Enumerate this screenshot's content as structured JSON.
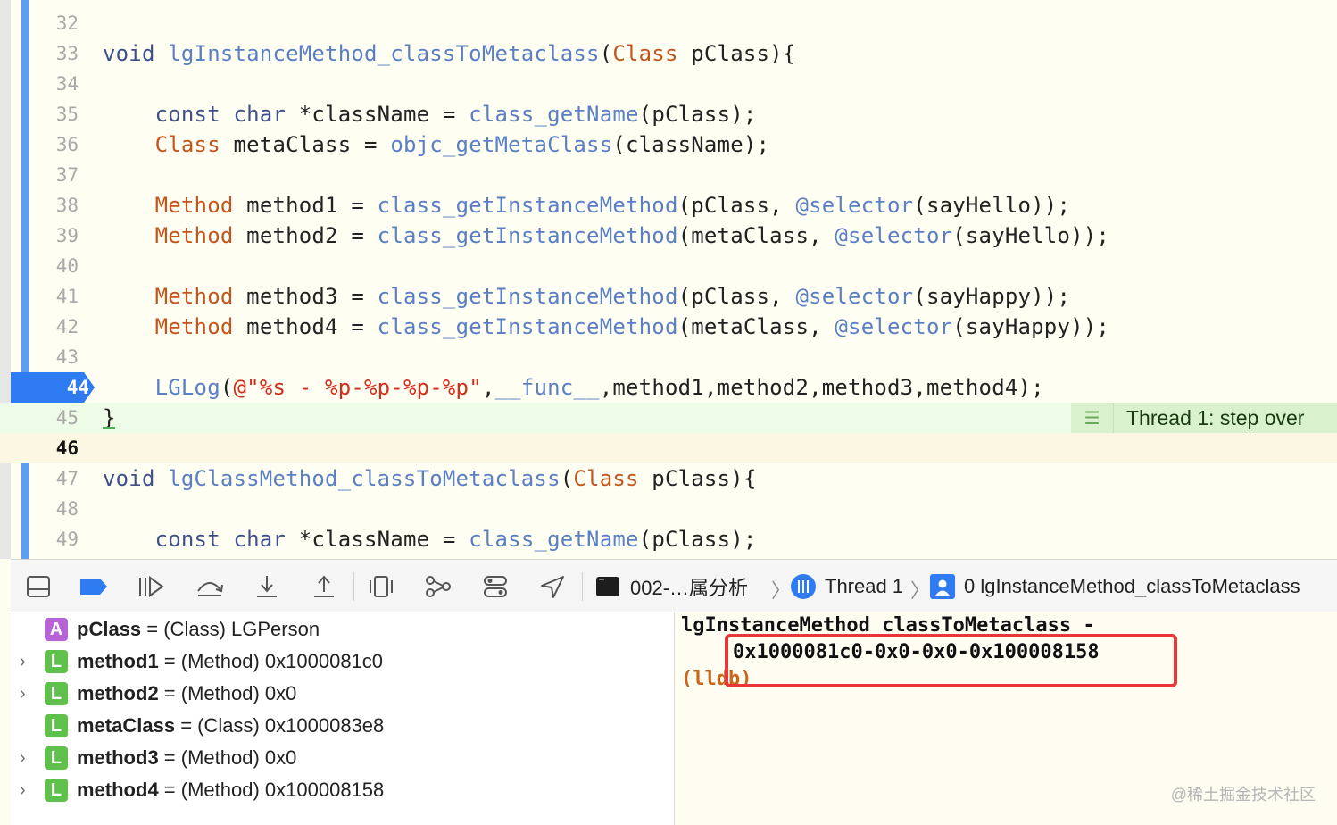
{
  "editor": {
    "lines": [
      {
        "num": "32",
        "tokens": []
      },
      {
        "num": "33",
        "tokens": [
          {
            "c": "t-kw",
            "t": "void "
          },
          {
            "c": "t-fn",
            "t": "lgInstanceMethod_classToMetaclass"
          },
          {
            "c": "t-plain",
            "t": "("
          },
          {
            "c": "t-type",
            "t": "Class"
          },
          {
            "c": "t-plain",
            "t": " pClass){"
          }
        ]
      },
      {
        "num": "34",
        "tokens": []
      },
      {
        "num": "35",
        "tokens": [
          {
            "c": "t-plain",
            "t": "    "
          },
          {
            "c": "t-kw",
            "t": "const char "
          },
          {
            "c": "t-plain",
            "t": "*className = "
          },
          {
            "c": "t-fn",
            "t": "class_getName"
          },
          {
            "c": "t-plain",
            "t": "(pClass);"
          }
        ]
      },
      {
        "num": "36",
        "tokens": [
          {
            "c": "t-plain",
            "t": "    "
          },
          {
            "c": "t-type",
            "t": "Class"
          },
          {
            "c": "t-plain",
            "t": " metaClass = "
          },
          {
            "c": "t-fn",
            "t": "objc_getMetaClass"
          },
          {
            "c": "t-plain",
            "t": "(className);"
          }
        ]
      },
      {
        "num": "37",
        "tokens": []
      },
      {
        "num": "38",
        "tokens": [
          {
            "c": "t-plain",
            "t": "    "
          },
          {
            "c": "t-type",
            "t": "Method"
          },
          {
            "c": "t-plain",
            "t": " method1 = "
          },
          {
            "c": "t-fn",
            "t": "class_getInstanceMethod"
          },
          {
            "c": "t-plain",
            "t": "(pClass, "
          },
          {
            "c": "t-fn",
            "t": "@selector"
          },
          {
            "c": "t-plain",
            "t": "(sayHello));"
          }
        ]
      },
      {
        "num": "39",
        "tokens": [
          {
            "c": "t-plain",
            "t": "    "
          },
          {
            "c": "t-type",
            "t": "Method"
          },
          {
            "c": "t-plain",
            "t": " method2 = "
          },
          {
            "c": "t-fn",
            "t": "class_getInstanceMethod"
          },
          {
            "c": "t-plain",
            "t": "(metaClass, "
          },
          {
            "c": "t-fn",
            "t": "@selector"
          },
          {
            "c": "t-plain",
            "t": "(sayHello));"
          }
        ]
      },
      {
        "num": "40",
        "tokens": []
      },
      {
        "num": "41",
        "tokens": [
          {
            "c": "t-plain",
            "t": "    "
          },
          {
            "c": "t-type",
            "t": "Method"
          },
          {
            "c": "t-plain",
            "t": " method3 = "
          },
          {
            "c": "t-fn",
            "t": "class_getInstanceMethod"
          },
          {
            "c": "t-plain",
            "t": "(pClass, "
          },
          {
            "c": "t-fn",
            "t": "@selector"
          },
          {
            "c": "t-plain",
            "t": "(sayHappy));"
          }
        ]
      },
      {
        "num": "42",
        "tokens": [
          {
            "c": "t-plain",
            "t": "    "
          },
          {
            "c": "t-type",
            "t": "Method"
          },
          {
            "c": "t-plain",
            "t": " method4 = "
          },
          {
            "c": "t-fn",
            "t": "class_getInstanceMethod"
          },
          {
            "c": "t-plain",
            "t": "(metaClass, "
          },
          {
            "c": "t-fn",
            "t": "@selector"
          },
          {
            "c": "t-plain",
            "t": "(sayHappy));"
          }
        ]
      },
      {
        "num": "43",
        "tokens": []
      },
      {
        "num": "44",
        "tokens": [
          {
            "c": "t-plain",
            "t": "    "
          },
          {
            "c": "t-fn",
            "t": "LGLog"
          },
          {
            "c": "t-plain",
            "t": "("
          },
          {
            "c": "t-str",
            "t": "@\"%s - %p-%p-%p-%p\""
          },
          {
            "c": "t-plain",
            "t": ","
          },
          {
            "c": "t-fn",
            "t": "__func__"
          },
          {
            "c": "t-plain",
            "t": ",method1,method2,method3,method4);"
          }
        ]
      },
      {
        "num": "45",
        "tokens": [
          {
            "c": "t-plain",
            "t": "}"
          }
        ]
      },
      {
        "num": "46",
        "tokens": []
      },
      {
        "num": "47",
        "tokens": [
          {
            "c": "t-kw",
            "t": "void "
          },
          {
            "c": "t-fn",
            "t": "lgClassMethod_classToMetaclass"
          },
          {
            "c": "t-plain",
            "t": "("
          },
          {
            "c": "t-type",
            "t": "Class"
          },
          {
            "c": "t-plain",
            "t": " pClass){"
          }
        ]
      },
      {
        "num": "48",
        "tokens": []
      },
      {
        "num": "49",
        "tokens": [
          {
            "c": "t-plain",
            "t": "    "
          },
          {
            "c": "t-kw",
            "t": "const char "
          },
          {
            "c": "t-plain",
            "t": "*className = "
          },
          {
            "c": "t-fn",
            "t": "class_getName"
          },
          {
            "c": "t-plain",
            "t": "(pClass);"
          }
        ]
      }
    ],
    "breakpoint_line": "44",
    "thread_badge": "Thread 1: step over"
  },
  "debug_bar": {
    "buttons": [
      "hide-debug-area-icon",
      "breakpoints-toggle-icon",
      "continue-icon",
      "step-over-icon",
      "step-into-icon",
      "step-out-icon",
      "view-hierarchy-icon",
      "memory-graph-icon",
      "environment-overrides-icon",
      "simulate-location-icon"
    ],
    "crumbs": {
      "target": "002-…属分析",
      "thread": "Thread 1",
      "frame": "0 lgInstanceMethod_classToMetaclass"
    }
  },
  "variables": [
    {
      "badge": "A",
      "name": "pClass",
      "rest": " = (Class) LGPerson",
      "expandable": false
    },
    {
      "badge": "L",
      "name": "method1",
      "rest": " = (Method) 0x1000081c0",
      "expandable": true
    },
    {
      "badge": "L",
      "name": "method2",
      "rest": " = (Method) 0x0",
      "expandable": true
    },
    {
      "badge": "L",
      "name": "metaClass",
      "rest": " = (Class) 0x1000083e8",
      "expandable": false
    },
    {
      "badge": "L",
      "name": "method3",
      "rest": " = (Method) 0x0",
      "expandable": true
    },
    {
      "badge": "L",
      "name": "method4",
      "rest": " = (Method) 0x100008158",
      "expandable": true
    }
  ],
  "console": {
    "line1": "lgInstanceMethod_classToMetaclass -",
    "line2": "0x1000081c0-0x0-0x0-0x100008158",
    "prompt": "(lldb)",
    "watermark": "@稀土掘金技术社区"
  },
  "colors": {
    "breakpoint": "#2f7bf2",
    "current_line": "#eefbe6",
    "highlight_box": "#e8363a"
  }
}
